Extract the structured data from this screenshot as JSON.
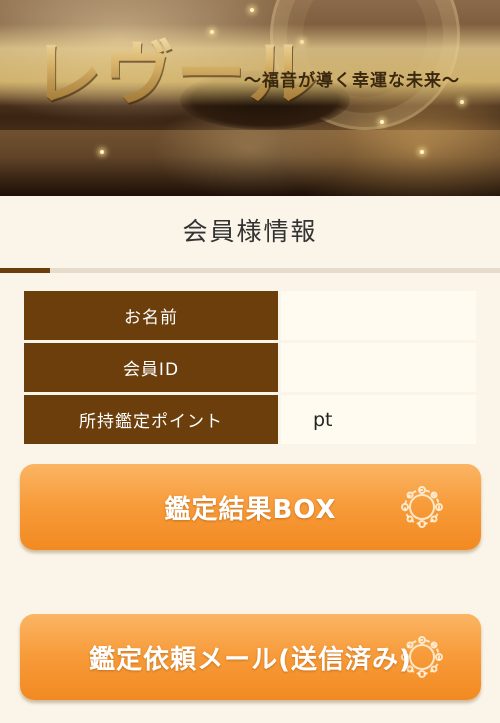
{
  "header": {
    "logo_title": "レヴール",
    "logo_subtitle": "〜福音が導く幸運な未来〜"
  },
  "section": {
    "title": "会員様情報"
  },
  "member_info": {
    "rows": [
      {
        "label": "お名前",
        "value": ""
      },
      {
        "label": "会員ID",
        "value": ""
      },
      {
        "label": "所持鑑定ポイント",
        "value": "pt"
      }
    ]
  },
  "buttons": {
    "result_box": "鑑定結果BOX",
    "request_mail": "鑑定依頼メール(送信済み)"
  },
  "colors": {
    "label_bg": "#6b3e0c",
    "button_orange": "#f79a38",
    "page_bg": "#fbf5e9"
  }
}
